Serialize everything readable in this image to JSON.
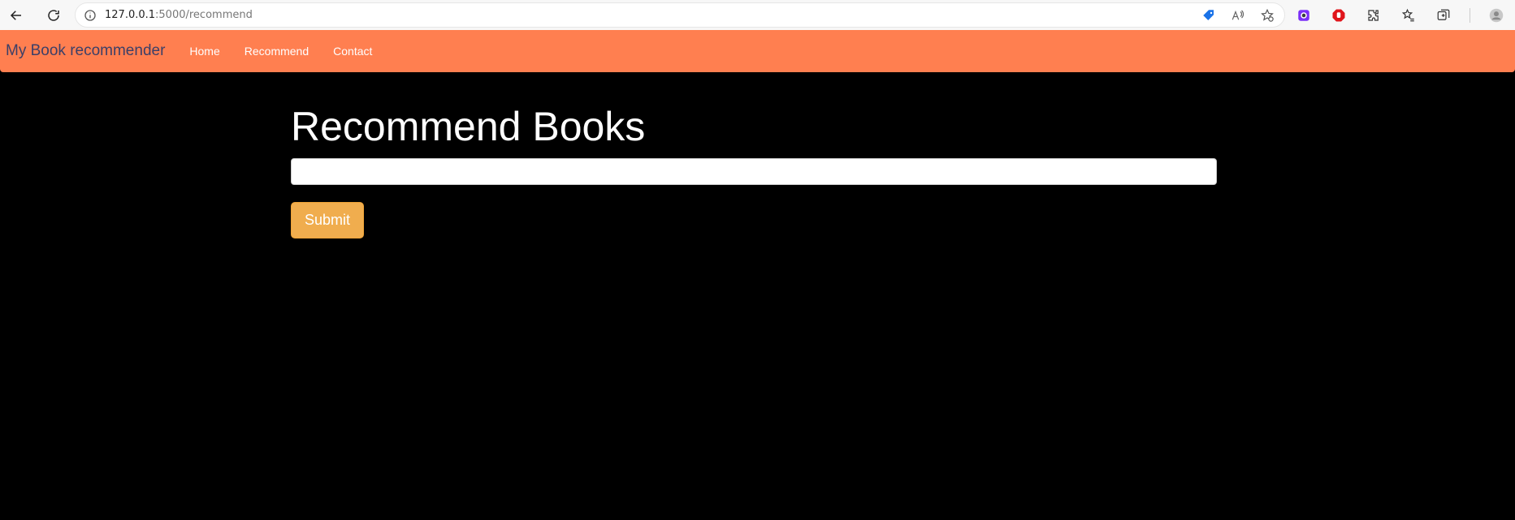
{
  "browser": {
    "url_host": "127.0.0.1",
    "url_rest": ":5000/recommend",
    "icons": [
      "back-icon",
      "refresh-icon",
      "info-icon",
      "tag-icon",
      "read-aloud-icon",
      "favorite-add-icon",
      "color-extension-icon",
      "adblock-icon",
      "extensions-icon",
      "favorites-icon",
      "collections-icon",
      "profile-icon"
    ],
    "colors": {
      "tag": "#1a73e8",
      "adblock": "#e0151b"
    }
  },
  "navbar": {
    "brand": "My Book recommender",
    "links": [
      "Home",
      "Recommend",
      "Contact"
    ],
    "background": "#ff7f50"
  },
  "main": {
    "title": "Recommend Books",
    "input_value": "",
    "submit_label": "Submit",
    "submit_color": "#f0ad4e"
  }
}
